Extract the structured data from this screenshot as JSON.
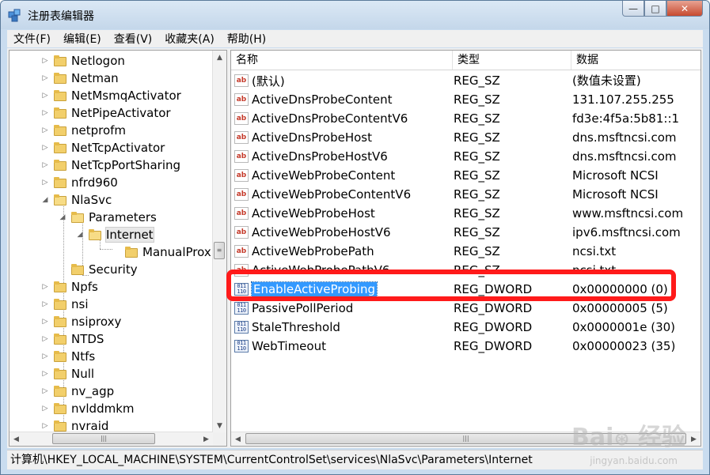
{
  "window": {
    "title": "注册表编辑器",
    "minimize": "—",
    "maximize": "□",
    "close": "✕"
  },
  "menu": [
    "文件(F)",
    "编辑(E)",
    "查看(V)",
    "收藏夹(A)",
    "帮助(H)"
  ],
  "tree": [
    {
      "label": "Netlogon",
      "expander": "▷"
    },
    {
      "label": "Netman",
      "expander": "▷"
    },
    {
      "label": "NetMsmqActivator",
      "expander": "▷"
    },
    {
      "label": "NetPipeActivator",
      "expander": "▷"
    },
    {
      "label": "netprofm",
      "expander": "▷"
    },
    {
      "label": "NetTcpActivator",
      "expander": "▷"
    },
    {
      "label": "NetTcpPortSharing",
      "expander": "▷"
    },
    {
      "label": "nfrd960",
      "expander": "▷"
    },
    {
      "label": "NlaSvc",
      "expander": "◢"
    },
    {
      "label": "Parameters",
      "expander": "◢"
    },
    {
      "label": "Internet",
      "expander": "◢"
    },
    {
      "label": "ManualProxies",
      "expander": ""
    },
    {
      "label": "Security",
      "expander": ""
    },
    {
      "label": "Npfs",
      "expander": "▷"
    },
    {
      "label": "nsi",
      "expander": "▷"
    },
    {
      "label": "nsiproxy",
      "expander": "▷"
    },
    {
      "label": "NTDS",
      "expander": "▷"
    },
    {
      "label": "Ntfs",
      "expander": "▷"
    },
    {
      "label": "Null",
      "expander": "▷"
    },
    {
      "label": "nv_agp",
      "expander": "▷"
    },
    {
      "label": "nvlddmkm",
      "expander": "▷"
    },
    {
      "label": "nvraid",
      "expander": "▷"
    }
  ],
  "list": {
    "columns": [
      "名称",
      "类型",
      "数据"
    ],
    "rows": [
      {
        "name": "(默认)",
        "type": "REG_SZ",
        "data": "(数值未设置)",
        "icon": "string-value-icon"
      },
      {
        "name": "ActiveDnsProbeContent",
        "type": "REG_SZ",
        "data": "131.107.255.255",
        "icon": "string-value-icon"
      },
      {
        "name": "ActiveDnsProbeContentV6",
        "type": "REG_SZ",
        "data": "fd3e:4f5a:5b81::1",
        "icon": "string-value-icon"
      },
      {
        "name": "ActiveDnsProbeHost",
        "type": "REG_SZ",
        "data": "dns.msftncsi.com",
        "icon": "string-value-icon"
      },
      {
        "name": "ActiveDnsProbeHostV6",
        "type": "REG_SZ",
        "data": "dns.msftncsi.com",
        "icon": "string-value-icon"
      },
      {
        "name": "ActiveWebProbeContent",
        "type": "REG_SZ",
        "data": "Microsoft NCSI",
        "icon": "string-value-icon"
      },
      {
        "name": "ActiveWebProbeContentV6",
        "type": "REG_SZ",
        "data": "Microsoft NCSI",
        "icon": "string-value-icon"
      },
      {
        "name": "ActiveWebProbeHost",
        "type": "REG_SZ",
        "data": "www.msftncsi.com",
        "icon": "string-value-icon"
      },
      {
        "name": "ActiveWebProbeHostV6",
        "type": "REG_SZ",
        "data": "ipv6.msftncsi.com",
        "icon": "string-value-icon"
      },
      {
        "name": "ActiveWebProbePath",
        "type": "REG_SZ",
        "data": "ncsi.txt",
        "icon": "string-value-icon"
      },
      {
        "name": "ActiveWebProbePathV6",
        "type": "REG_SZ",
        "data": "ncsi.txt",
        "icon": "string-value-icon"
      },
      {
        "name": "EnableActiveProbing",
        "type": "REG_DWORD",
        "data": "0x00000000 (0)",
        "icon": "dword-value-icon"
      },
      {
        "name": "PassivePollPeriod",
        "type": "REG_DWORD",
        "data": "0x00000005 (5)",
        "icon": "dword-value-icon"
      },
      {
        "name": "StaleThreshold",
        "type": "REG_DWORD",
        "data": "0x0000001e (30)",
        "icon": "dword-value-icon"
      },
      {
        "name": "WebTimeout",
        "type": "REG_DWORD",
        "data": "0x00000023 (35)",
        "icon": "dword-value-icon"
      }
    ],
    "selected_row": "EnableActiveProbing"
  },
  "icons": {
    "string": "ab",
    "dword": "011\n110"
  },
  "status": "计算机\\HKEY_LOCAL_MACHINE\\SYSTEM\\CurrentControlSet\\services\\NlaSvc\\Parameters\\Internet",
  "watermark": {
    "brand": "Baidu 经验",
    "url": "jingyan.baidu.com"
  },
  "colors": {
    "highlight": "#ff1a1a",
    "selection": "#3399ff"
  }
}
